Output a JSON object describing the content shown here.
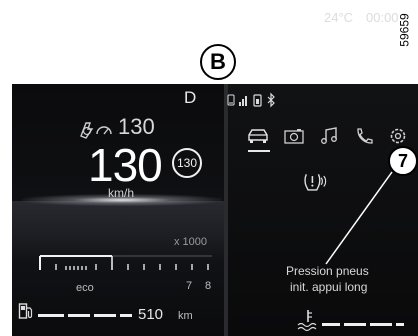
{
  "figure": {
    "reference_number": "59659",
    "view_label": "B",
    "callout_number": "7"
  },
  "left_display": {
    "gear": "D",
    "limiter_icon": "speed-limiter-icon",
    "limit_speed": "130",
    "speed": "130",
    "speed_sign": "130",
    "speed_unit": "km/h",
    "rpm_scale_label": "x 1000",
    "eco_label": "eco",
    "rpm_tick_7": "7",
    "rpm_tick_8": "8",
    "fuel_icon": "fuel-pump-icon",
    "range_value": "510",
    "range_unit": "km"
  },
  "right_display": {
    "status_icons": [
      "phone-icon",
      "signal-icon",
      "battery-icon",
      "bluetooth-icon"
    ],
    "temperature": "24°C",
    "time": "00:00",
    "tabs": [
      {
        "icon": "car-icon",
        "active": true
      },
      {
        "icon": "camera-icon",
        "active": false
      },
      {
        "icon": "music-icon",
        "active": false
      },
      {
        "icon": "phone-icon",
        "active": false
      },
      {
        "icon": "settings-icon",
        "active": false
      }
    ],
    "tpms_icon": "tyre-pressure-icon",
    "message_line1": "Pression pneus",
    "message_line2": "init. appui long",
    "coolant_icon": "coolant-temperature-icon"
  },
  "colors": {
    "background": "#0b0b0d",
    "text": "#e8e8e8",
    "page": "#ffffff"
  }
}
